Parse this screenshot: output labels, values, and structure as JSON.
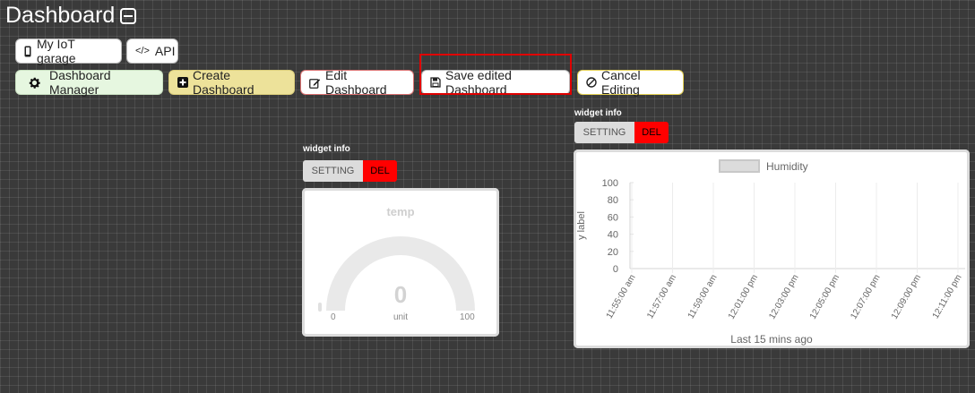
{
  "header": {
    "title": "Dashboard"
  },
  "nav": {
    "garage_label": "My IoT garage",
    "api_label": "API",
    "api_icon": "</>"
  },
  "toolbar": {
    "manager_label": "Dashboard Manager",
    "create_label": "Create Dashboard",
    "edit_label": "Edit Dashboard",
    "save_label": "Save edited Dashboard",
    "cancel_label": "Cancel Editing"
  },
  "widget_gauge": {
    "info": "widget info",
    "setting": "SETTING",
    "del": "DEL",
    "title": "temp",
    "value": "0",
    "unit": "unit",
    "min": "0",
    "max": "100",
    "level": 0
  },
  "widget_chart": {
    "info": "widget info",
    "setting": "SETTING",
    "del": "DEL",
    "footer": "Last 15 mins ago"
  },
  "chart_data": {
    "type": "line",
    "series": [
      {
        "name": "Humidity",
        "values": []
      }
    ],
    "ylabel": "y label",
    "xlabel": "",
    "ylim": [
      0,
      100
    ],
    "yticks": [
      "100",
      "80",
      "60",
      "40",
      "20",
      "0"
    ],
    "categories": [
      "11:55:00 am",
      "11:57:00 am",
      "11:59:00 am",
      "12:01:00 pm",
      "12:03:00 pm",
      "12:05:00 pm",
      "12:07:00 pm",
      "12:09:00 pm",
      "12:11:00 pm"
    ],
    "grid": true,
    "legend": "top",
    "legend_color": "#dcdcdc"
  },
  "colors": {
    "del": "#ff0000",
    "highlight": "#e00000",
    "create": "#ede29a",
    "manager": "#e6f7e0"
  }
}
